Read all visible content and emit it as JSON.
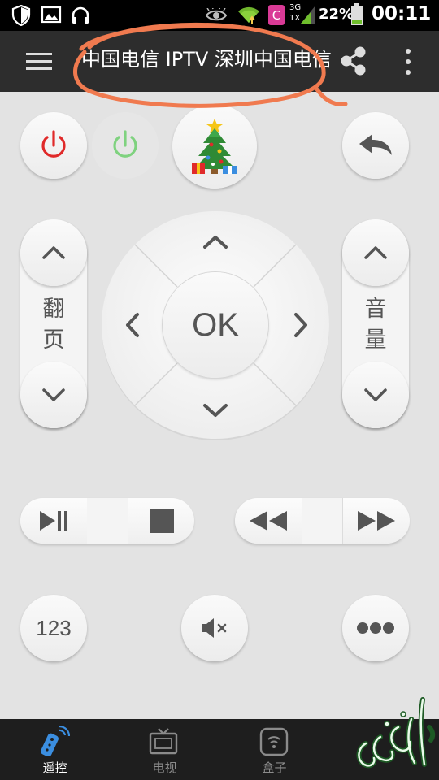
{
  "status_bar": {
    "icons": [
      "shield-icon",
      "image-icon",
      "headphones-icon",
      "eye-icon",
      "wifi-icon",
      "app-c-icon",
      "signal-icon",
      "battery-icon"
    ],
    "network_top": "3G",
    "network_bottom": "1X",
    "battery": "22%",
    "time": "00:11"
  },
  "header": {
    "title": "中国电信 IPTV 深圳中国电信",
    "icons": [
      "menu-icon",
      "share-icon",
      "more-vert-icon"
    ]
  },
  "remote": {
    "page_label_1": "翻",
    "page_label_2": "页",
    "volume_label_1": "音",
    "volume_label_2": "量",
    "ok_label": "OK",
    "numpad_label": "123"
  },
  "bottom_nav": {
    "items": [
      {
        "label": "遥控",
        "icon": "remote-icon",
        "active": true
      },
      {
        "label": "电视",
        "icon": "tv-icon",
        "active": false
      },
      {
        "label": "盒子",
        "icon": "box-icon",
        "active": false
      }
    ]
  },
  "colors": {
    "power_red": "#e02a2a",
    "power_green": "#7fd27f",
    "accent_blue": "#3b8ee0",
    "annotation": "#f07a4f"
  }
}
